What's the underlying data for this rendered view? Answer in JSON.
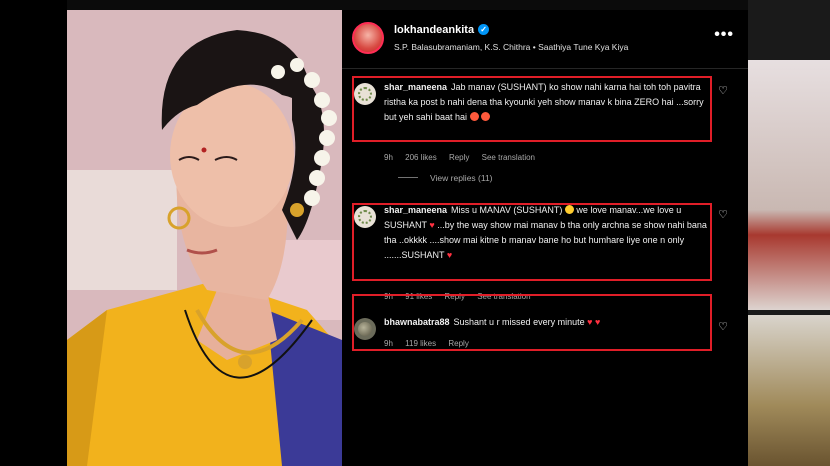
{
  "post": {
    "username": "lokhandeankita",
    "song": "S.P. Balasubramaniam, K.S. Chithra • Saathiya Tune Kya Kiya",
    "more_icon": "more-horizontal-icon",
    "verified_icon": "verified-badge-icon"
  },
  "comments": [
    {
      "username": "shar_maneena",
      "text": "Jab manav (SUSHANT) ko show nahi karna hai toh toh pavitra ristha ka post b nahi dena tha kyounki yeh show manav k bina ZERO hai ...sorry but yeh sahi baat hai",
      "time": "9h",
      "likes": "206 likes",
      "reply": "Reply",
      "translate": "See translation",
      "view_replies": "View replies (11)"
    },
    {
      "username": "shar_maneena",
      "text_a": "Miss u MANAV (SUSHANT)",
      "text_b": "we love manav...we love u SUSHANT",
      "text_c": "...by the way show mai manav b tha only archna se show nahi bana tha ..okkkk ....show mai kitne b manav bane ho but humhare liye one n only .......SUSHANT",
      "time": "9h",
      "likes": "91 likes",
      "reply": "Reply",
      "translate": "See translation"
    },
    {
      "username": "bhawnabatra88",
      "text": "Sushant u r missed every minute",
      "time": "9h",
      "likes": "119 likes",
      "reply": "Reply"
    }
  ],
  "colors": {
    "highlight": "#e01e28",
    "verified": "#0095f6",
    "panel_bg": "#000000",
    "muted_text": "#a8a8a8"
  }
}
